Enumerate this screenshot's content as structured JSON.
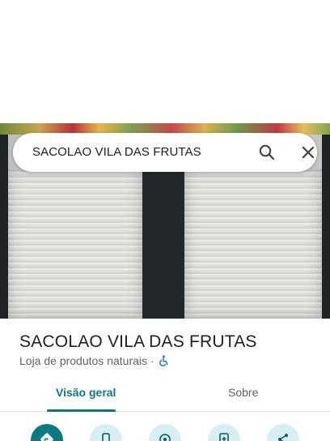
{
  "search": {
    "query": "SACOLAO VILA DAS FRUTAS",
    "search_icon": "search-icon",
    "close_icon": "close-icon"
  },
  "place": {
    "name": "SACOLAO VILA DAS FRUTAS",
    "category": "Loja de produtos naturais",
    "separator": "·",
    "accessibility_icon": "wheelchair-icon"
  },
  "tabs": [
    {
      "label": "Visão geral",
      "active": true
    },
    {
      "label": "Sobre",
      "active": false
    }
  ],
  "actions": [
    {
      "icon": "directions-icon"
    },
    {
      "icon": "phone-icon"
    },
    {
      "icon": "location-icon"
    },
    {
      "icon": "save-icon"
    },
    {
      "icon": "share-icon"
    }
  ],
  "colors": {
    "accent": "#0b7a80",
    "action_bg": "#d7eff2",
    "text": "#202124",
    "secondary_text": "#5f6368",
    "accessibility_blue": "#1a73e8"
  }
}
